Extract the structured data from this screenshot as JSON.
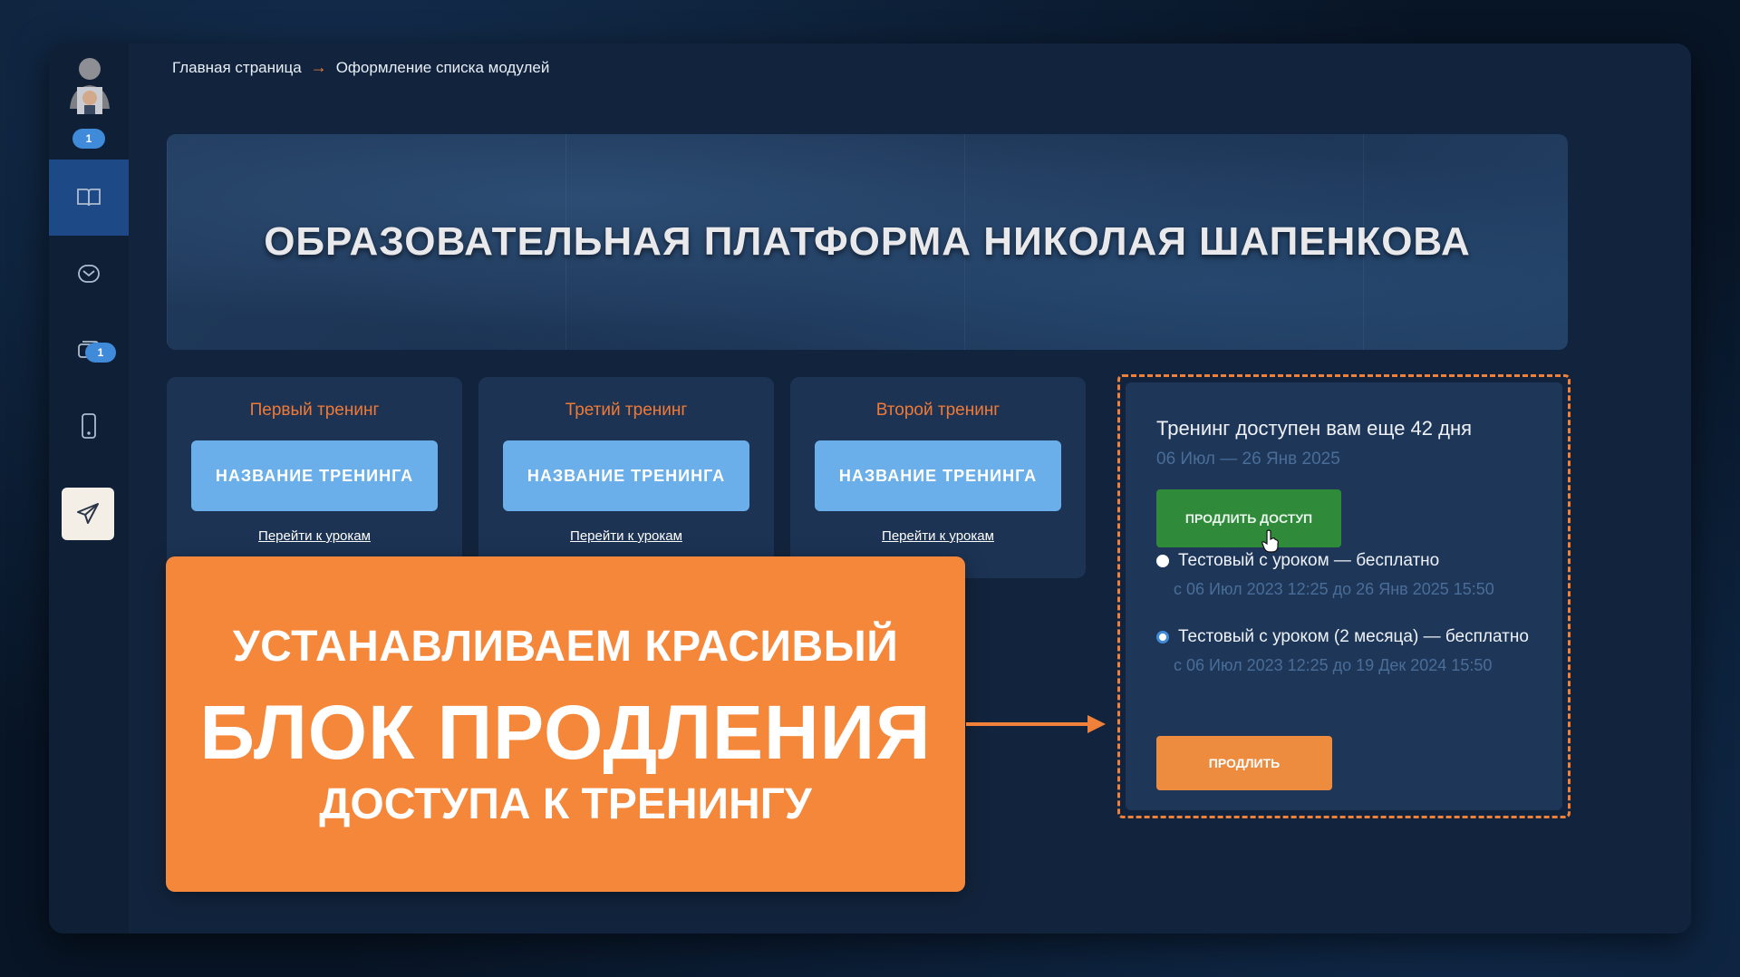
{
  "breadcrumb": {
    "home": "Главная страница",
    "separator": "→",
    "current": "Оформление списка модулей"
  },
  "sidebar": {
    "avatar_badge": "1",
    "items": [
      {
        "icon": "book-icon",
        "active": true
      },
      {
        "icon": "mail-icon",
        "active": false
      },
      {
        "icon": "tickets-icon",
        "badge": "1",
        "active": false
      },
      {
        "icon": "phone-icon",
        "active": false
      },
      {
        "icon": "telegram-icon",
        "active": false
      }
    ]
  },
  "banner": {
    "title": "ОБРАЗОВАТЕЛЬНАЯ ПЛАТФОРМА НИКОЛАЯ ШАПЕНКОВА"
  },
  "trainings": [
    {
      "title": "Первый тренинг",
      "button": "НАЗВАНИЕ ТРЕНИНГА",
      "link": "Перейти к урокам"
    },
    {
      "title": "Третий тренинг",
      "button": "НАЗВАНИЕ ТРЕНИНГА",
      "link": "Перейти к урокам"
    },
    {
      "title": "Второй тренинг",
      "button": "НАЗВАНИЕ ТРЕНИНГА",
      "link": "Перейти к урокам"
    }
  ],
  "renewal": {
    "title": "Тренинг доступен вам еще 42 дня",
    "dates": "06 Июл — 26 Янв 2025",
    "extend_button": "ПРОДЛИТЬ ДОСТУП",
    "options": [
      {
        "label": "Тестовый с уроком — бесплатно",
        "dates": "с 06 Июл 2023 12:25 до 26 Янв 2025 15:50",
        "selected": false
      },
      {
        "label": "Тестовый с уроком (2 месяца) — бесплатно",
        "dates": "с 06 Июл 2023 12:25 до 19 Дек 2024 15:50",
        "selected": true
      }
    ],
    "renew_button": "ПРОДЛИТЬ"
  },
  "promo": {
    "line1": "УСТАНАВЛИВАЕМ КРАСИВЫЙ",
    "line2": "БЛОК ПРОДЛЕНИЯ",
    "line3": "ДОСТУПА К ТРЕНИНГУ"
  },
  "colors": {
    "accent_orange": "#f5873a",
    "accent_blue": "#6aaeea",
    "extend_green": "#2f8a3a",
    "panel": "#1e3658",
    "background": "#081526"
  }
}
